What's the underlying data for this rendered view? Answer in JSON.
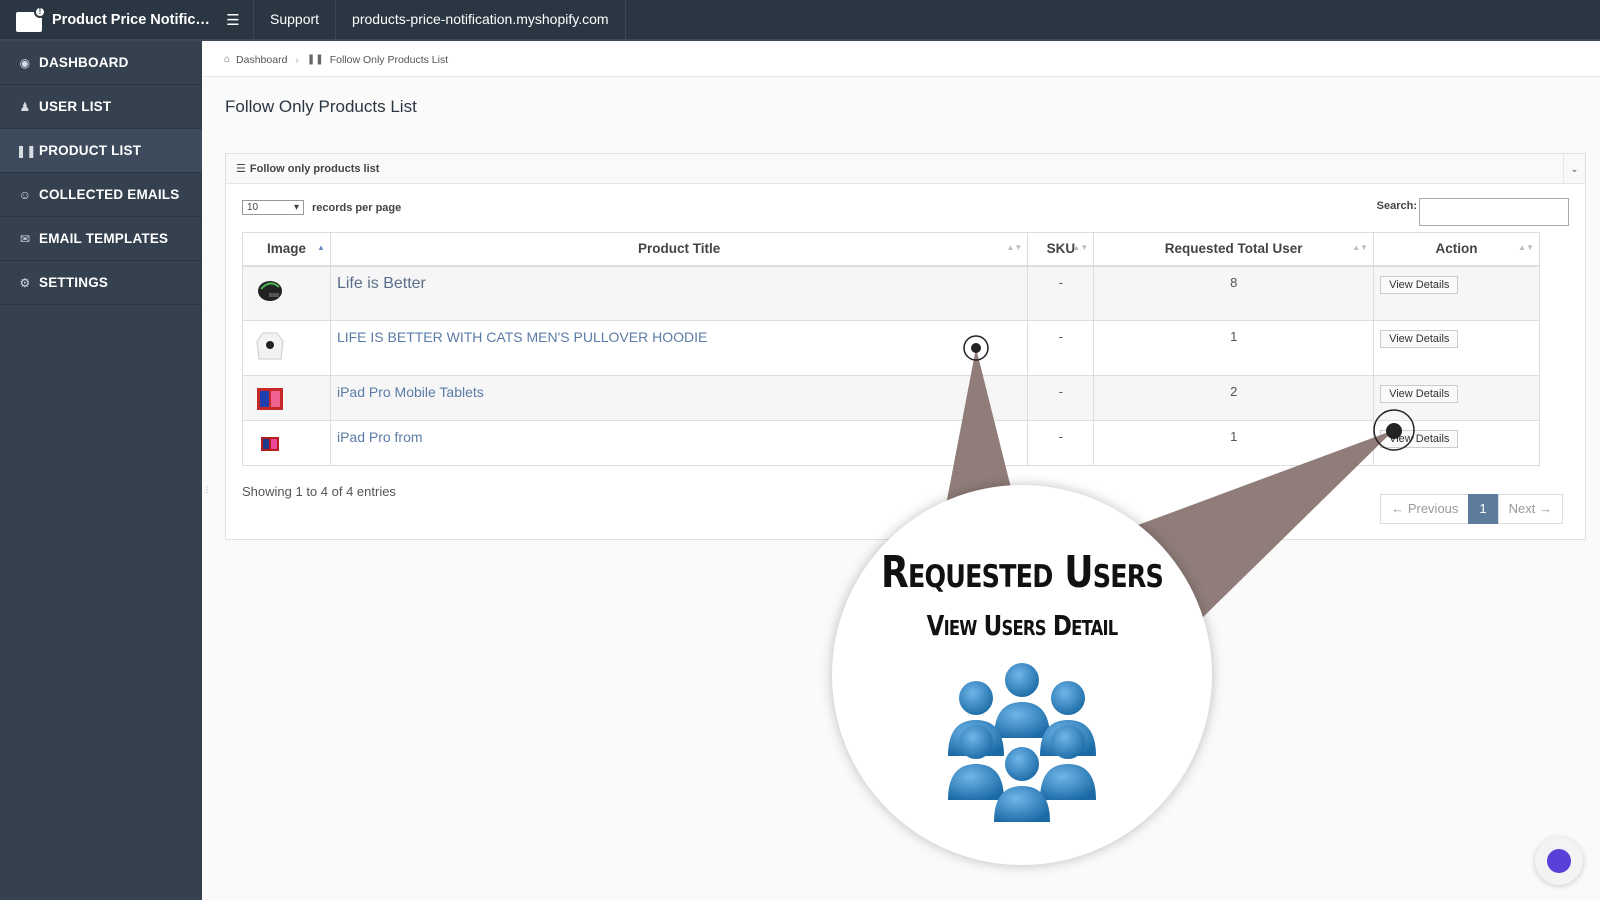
{
  "app": {
    "title": "Product Price Notificati...",
    "support_label": "Support",
    "store_domain": "products-price-notification.myshopify.com"
  },
  "sidebar": {
    "items": [
      {
        "label": "DASHBOARD",
        "icon": "dashboard-icon"
      },
      {
        "label": "USER LIST",
        "icon": "users-icon"
      },
      {
        "label": "PRODUCT LIST",
        "icon": "barcode-icon",
        "active": true
      },
      {
        "label": "COLLECTED EMAILS",
        "icon": "smile-icon"
      },
      {
        "label": "EMAIL TEMPLATES",
        "icon": "envelope-icon"
      },
      {
        "label": "SETTINGS",
        "icon": "gear-icon"
      }
    ]
  },
  "breadcrumb": {
    "home": "Dashboard",
    "current": "Follow Only Products List"
  },
  "page": {
    "title": "Follow Only Products List",
    "panel_title": "Follow only products list"
  },
  "table_controls": {
    "page_size": "10",
    "page_size_label": "records per page",
    "search_label": "Search:",
    "search_value": ""
  },
  "table": {
    "columns": [
      "Image",
      "Product Title",
      "SKU",
      "Requested Total User",
      "Action"
    ],
    "rows": [
      {
        "title": "Life is Better",
        "sku": "-",
        "requested": "8",
        "action": "View Details"
      },
      {
        "title": "LIFE IS BETTER WITH CATS MEN'S PULLOVER HOODIE",
        "sku": "-",
        "requested": "1",
        "action": "View Details"
      },
      {
        "title": "iPad Pro Mobile Tablets",
        "sku": "-",
        "requested": "2",
        "action": "View Details"
      },
      {
        "title": "iPad Pro from",
        "sku": "-",
        "requested": "1",
        "action": "View Details"
      }
    ]
  },
  "footer": {
    "info": "Showing 1 to 4 of 4 entries",
    "prev": "← Previous",
    "current_page": "1",
    "next": "Next →"
  },
  "callout": {
    "title": "Requested Users",
    "subtitle": "View Users Detail"
  },
  "colors": {
    "topbar": "#2b3643",
    "sidebar": "#364150",
    "accent": "#5d7b9d",
    "callout_beam": "#8a7672"
  }
}
